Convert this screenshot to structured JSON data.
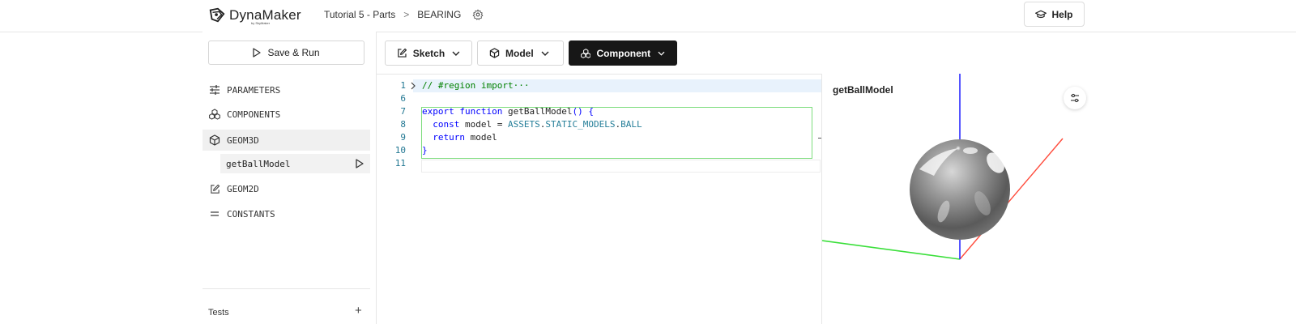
{
  "header": {
    "logo_text": "DynaMaker",
    "logo_sub": "by SkyMaker",
    "breadcrumb": [
      "Tutorial 5 - Parts",
      ">",
      "BEARING"
    ],
    "help_label": "Help"
  },
  "sidebar": {
    "save_run_label": "Save & Run",
    "items": [
      {
        "label": "PARAMETERS",
        "icon": "sliders-icon"
      },
      {
        "label": "COMPONENTS",
        "icon": "components-icon"
      },
      {
        "label": "GEOM3D",
        "icon": "cube-icon"
      },
      {
        "label": "GEOM2D",
        "icon": "edit-icon"
      },
      {
        "label": "CONSTANTS",
        "icon": "equals-icon"
      }
    ],
    "sub_item": "getBallModel",
    "tests_label": "Tests"
  },
  "toolbar": {
    "sketch_label": "Sketch",
    "model_label": "Model",
    "component_label": "Component"
  },
  "editor": {
    "lines": [
      {
        "no": "1",
        "parts": [
          {
            "t": "// #region import",
            "c": "cm"
          },
          {
            "t": "···",
            "c": "cm"
          }
        ]
      },
      {
        "no": "6",
        "parts": []
      },
      {
        "no": "7",
        "parts": [
          {
            "t": "export",
            "c": "kw"
          },
          {
            "t": " ",
            "c": "fn"
          },
          {
            "t": "function",
            "c": "kw"
          },
          {
            "t": " getBallModel",
            "c": "fn"
          },
          {
            "t": "() {",
            "c": "kw"
          }
        ]
      },
      {
        "no": "8",
        "parts": [
          {
            "t": "  ",
            "c": "fn"
          },
          {
            "t": "const",
            "c": "kw"
          },
          {
            "t": " model = ",
            "c": "fn"
          },
          {
            "t": "ASSETS",
            "c": "ty"
          },
          {
            "t": ".",
            "c": "fn"
          },
          {
            "t": "STATIC_MODELS",
            "c": "ty"
          },
          {
            "t": ".",
            "c": "fn"
          },
          {
            "t": "BALL",
            "c": "ty"
          }
        ]
      },
      {
        "no": "9",
        "parts": [
          {
            "t": "  ",
            "c": "fn"
          },
          {
            "t": "return",
            "c": "kw"
          },
          {
            "t": " model",
            "c": "fn"
          }
        ]
      },
      {
        "no": "10",
        "parts": [
          {
            "t": "}",
            "c": "kw"
          }
        ]
      },
      {
        "no": "11",
        "parts": []
      }
    ]
  },
  "viewer": {
    "title": "getBallModel"
  },
  "colors": {
    "accent_dark": "#171717",
    "axis_x": "#ff4b3b",
    "axis_y": "#2b2bff",
    "axis_z": "#3adf3a",
    "code_keyword": "#0000ff",
    "code_comment": "#008000",
    "code_type": "#267f99"
  }
}
